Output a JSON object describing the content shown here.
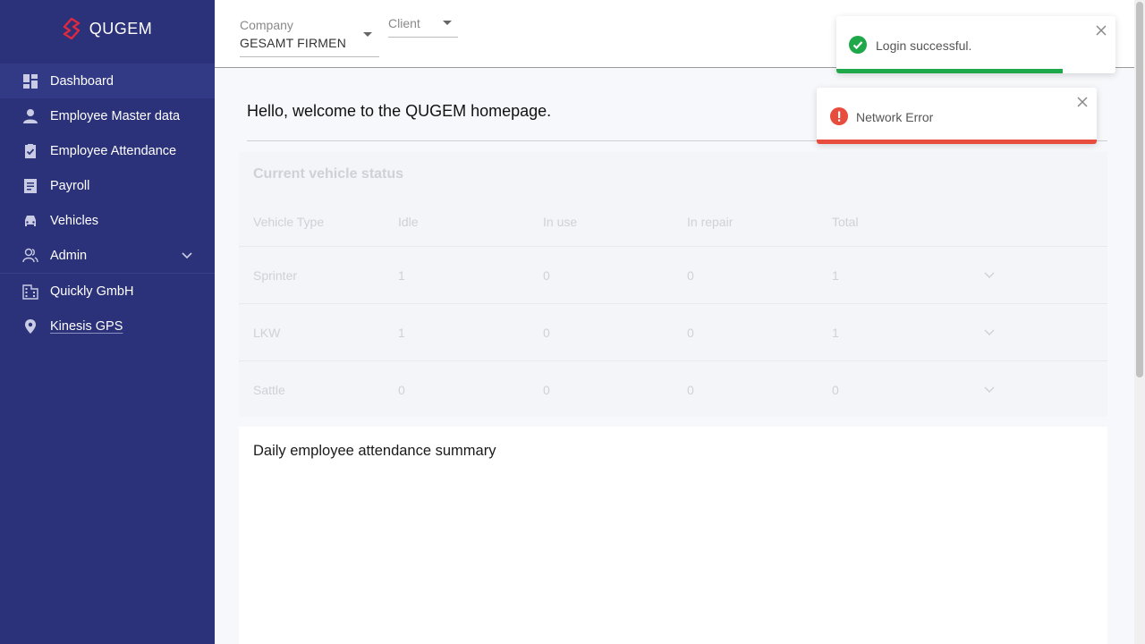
{
  "app": {
    "name": "QUGEM"
  },
  "sidebar": {
    "items": [
      {
        "label": "Dashboard",
        "icon": "dashboard-icon",
        "active": true
      },
      {
        "label": "Employee Master data",
        "icon": "person-icon"
      },
      {
        "label": "Employee Attendance",
        "icon": "clipboard-check-icon"
      },
      {
        "label": "Payroll",
        "icon": "receipt-icon"
      },
      {
        "label": "Vehicles",
        "icon": "car-icon"
      },
      {
        "label": "Admin",
        "icon": "people-icon",
        "expandable": true
      },
      {
        "label": "Quickly GmbH",
        "icon": "building-icon"
      },
      {
        "label": "Kinesis GPS",
        "icon": "location-pin-icon"
      }
    ]
  },
  "topbar": {
    "company": {
      "label": "Company",
      "value": "GESAMT FIRMEN"
    },
    "client": {
      "label": "Client"
    }
  },
  "main": {
    "welcome": "Hello, welcome to the QUGEM homepage.",
    "vehicle_status": {
      "title": "Current vehicle status",
      "columns": [
        "Vehicle Type",
        "Idle",
        "In use",
        "In repair",
        "Total"
      ],
      "rows": [
        {
          "type": "Sprinter",
          "idle": "1",
          "in_use": "0",
          "in_repair": "0",
          "total": "1"
        },
        {
          "type": "LKW",
          "idle": "1",
          "in_use": "0",
          "in_repair": "0",
          "total": "1"
        },
        {
          "type": "Sattle",
          "idle": "0",
          "in_use": "0",
          "in_repair": "0",
          "total": "0"
        }
      ]
    },
    "attendance": {
      "title": "Daily employee attendance summary"
    }
  },
  "toasts": {
    "success": {
      "text": "Login successful.",
      "color": "#1ea84a",
      "progress": 0.81
    },
    "error": {
      "text": "Network Error",
      "color": "#e74c3c"
    }
  },
  "colors": {
    "sidebar": "#2b3279",
    "brand_accent": "#e0293e"
  }
}
